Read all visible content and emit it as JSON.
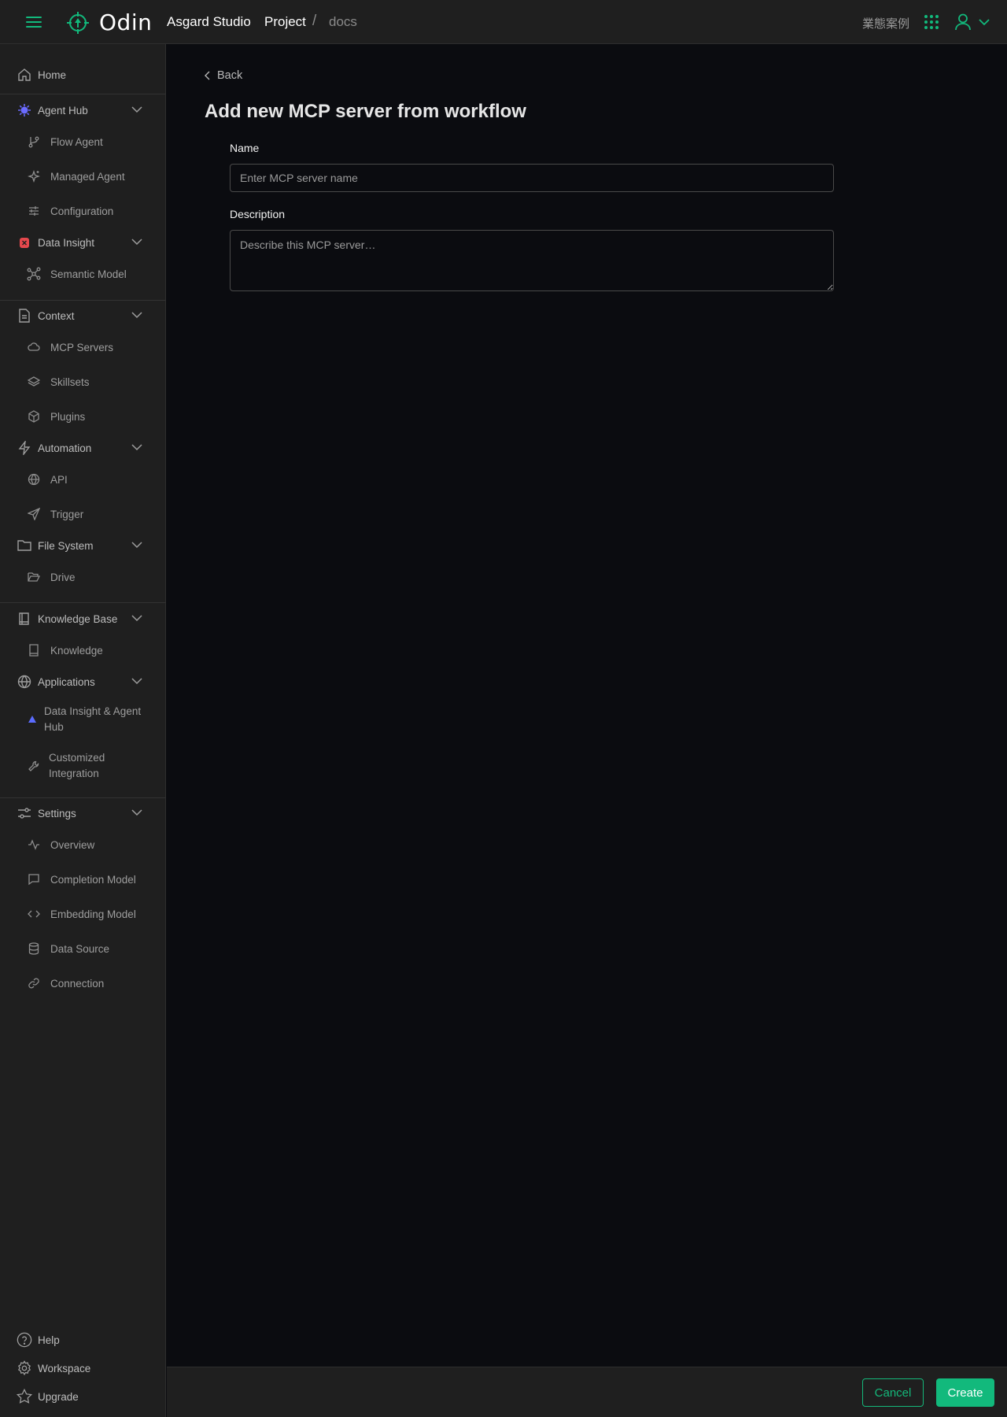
{
  "header": {
    "brand": "Odin",
    "org": "Asgard Studio",
    "breadcrumb": {
      "project": "Project",
      "separator": "/",
      "current": "docs"
    },
    "cases_link": "業態案例"
  },
  "icons": {
    "menu": "hamburger-icon",
    "logo": "odin-logo-icon",
    "apps": "apps-grid-icon",
    "user": "user-icon",
    "expand": "chevron-down-icon"
  },
  "colors": {
    "accent": "#12b97c",
    "background": "#0b0c10",
    "panel": "#1f1f1f",
    "agent_hub": "#6b6bff",
    "data_insight": "#e5484d",
    "app_triangle": "#5b6cff"
  },
  "sidebar": {
    "home": "Home",
    "agent_hub": {
      "label": "Agent Hub",
      "items": [
        "Flow Agent",
        "Managed Agent",
        "Configuration"
      ]
    },
    "data_insight": {
      "label": "Data Insight",
      "items": [
        "Semantic Model"
      ]
    },
    "context": {
      "label": "Context",
      "items": [
        "MCP Servers",
        "Skillsets",
        "Plugins"
      ]
    },
    "automation": {
      "label": "Automation",
      "items": [
        "API",
        "Trigger"
      ]
    },
    "file_system": {
      "label": "File System",
      "items": [
        "Drive"
      ]
    },
    "knowledge_base": {
      "label": "Knowledge Base",
      "items": [
        "Knowledge"
      ]
    },
    "applications": {
      "label": "Applications",
      "items": [
        "Data Insight & Agent Hub",
        "Customized Integration"
      ]
    },
    "settings": {
      "label": "Settings",
      "items": [
        "Overview",
        "Completion Model",
        "Embedding Model",
        "Data Source",
        "Connection"
      ]
    },
    "bottom": {
      "help": "Help",
      "workspace": "Workspace",
      "upgrade": "Upgrade"
    }
  },
  "main": {
    "back_label": "Back",
    "title": "Add new MCP server from workflow",
    "form": {
      "name_label": "Name",
      "name_placeholder": "Enter MCP server name",
      "name_value": "",
      "description_label": "Description",
      "description_placeholder": "Describe this MCP server…",
      "description_value": ""
    }
  },
  "footer": {
    "cancel_label": "Cancel",
    "create_label": "Create"
  }
}
